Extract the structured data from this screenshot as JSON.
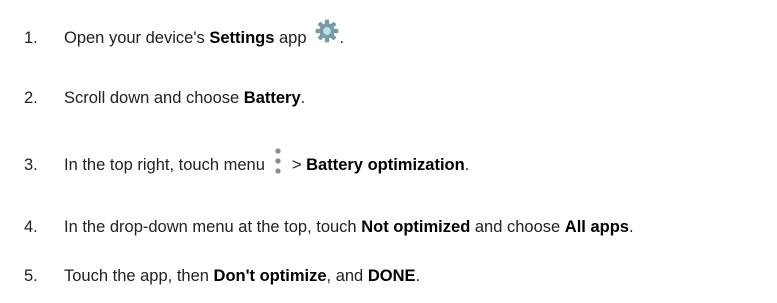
{
  "steps": [
    {
      "number": "1.",
      "text_before": "Open your device's ",
      "bold_1": "Settings",
      "text_after": " app",
      "icon": "settings-gear-icon",
      "trail": "."
    },
    {
      "number": "2.",
      "text_before": "Scroll down and choose ",
      "bold_1": "Battery",
      "trail": "."
    },
    {
      "number": "3.",
      "text_before": "In the top right, touch menu",
      "icon": "more-vert-icon",
      "text_mid": "> ",
      "bold_1": "Battery optimization",
      "trail": "."
    },
    {
      "number": "4.",
      "text_before": "In the drop-down menu at the top, touch ",
      "bold_1": "Not optimized",
      "text_mid": " and choose ",
      "bold_2": "All apps",
      "trail": "."
    },
    {
      "number": "5.",
      "text_before": "Touch the app, then ",
      "bold_1": "Don't optimize",
      "text_mid": ", and ",
      "bold_2": "DONE",
      "trail": "."
    }
  ],
  "colors": {
    "text": "#202124",
    "bold": "#000000",
    "gear": "#7a9aa6",
    "gear_center": "#b3e5ea",
    "menu_dots": "#8a8a8a"
  }
}
